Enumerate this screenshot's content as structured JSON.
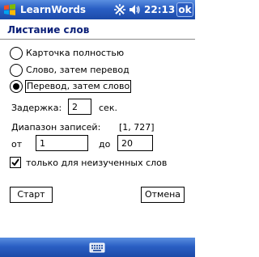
{
  "titlebar": {
    "app_title": "LearnWords",
    "clock": "22:13",
    "ok_label": "ok",
    "icons": [
      "windows-start-icon",
      "connectivity-icon",
      "volume-icon"
    ]
  },
  "page": {
    "title": "Листание слов"
  },
  "mode": {
    "options": [
      {
        "label": "Карточка полностью",
        "checked": false
      },
      {
        "label": "Слово, затем перевод",
        "checked": false
      },
      {
        "label": "Перевод, затем слово",
        "checked": true
      }
    ]
  },
  "delay": {
    "label": "Задержка:",
    "value": "2",
    "unit": "сек."
  },
  "range": {
    "label": "Диапазон записей:",
    "value": "[1, 727]",
    "from_label": "от",
    "from_value": "1",
    "to_label": "до",
    "to_value": "20"
  },
  "filter": {
    "label": "только для неизученных слов",
    "checked": true
  },
  "buttons": {
    "start": "Старт",
    "cancel": "Отмена"
  },
  "bottombar": {
    "icon": "keyboard-icon"
  },
  "colors": {
    "titlebar": "#2a5fc4",
    "heading": "#0a1f78"
  }
}
